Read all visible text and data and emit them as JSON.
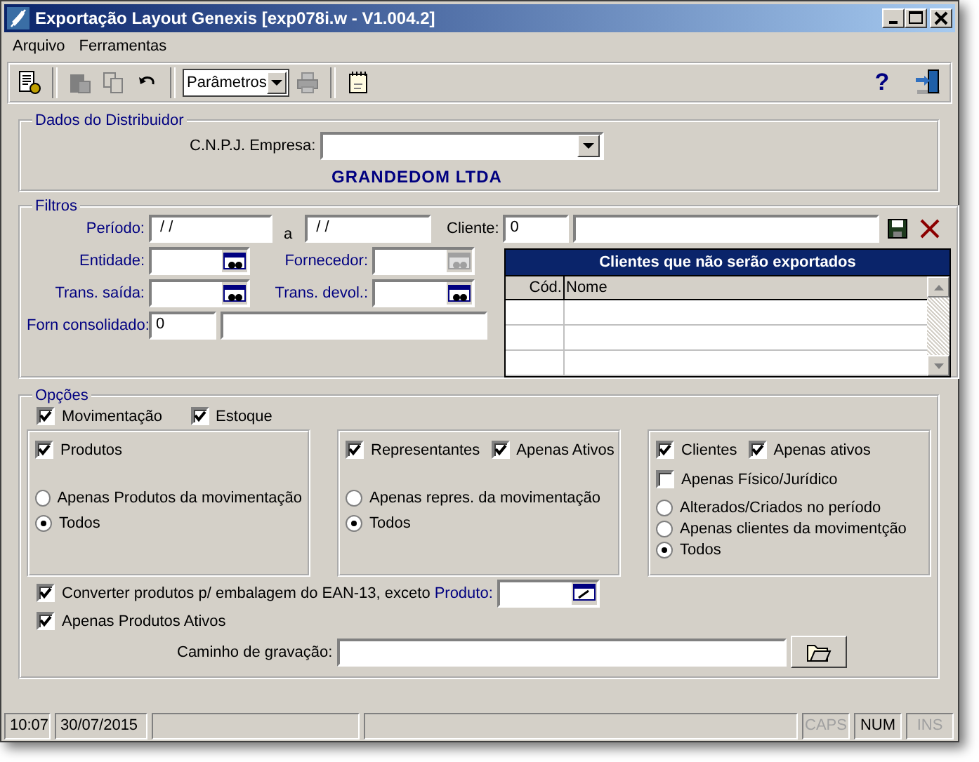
{
  "window": {
    "title": "Exportação Layout Genexis [exp078i.w - V1.004.2]"
  },
  "menu": [
    {
      "label": "Arquivo"
    },
    {
      "label": "Ferramentas"
    }
  ],
  "toolbar": {
    "combo_value": "Parâmetros",
    "help": "?"
  },
  "distribuidor": {
    "title": "Dados do Distribuidor",
    "cnpj_label": "C.N.P.J. Empresa:",
    "company": "GRANDEDOM LTDA"
  },
  "filtros": {
    "title": "Filtros",
    "periodo_label": "Período:",
    "periodo_from": " / /",
    "between": "a",
    "periodo_to": " / /",
    "cliente_label": "Cliente:",
    "cliente_code": "0",
    "lookups": [
      {
        "label": "Entidade:",
        "disabled": false
      },
      {
        "label": "Fornecedor:",
        "disabled": true
      },
      {
        "label": "Trans. saída:",
        "disabled": false
      },
      {
        "label": "Trans. devol.:",
        "disabled": false
      }
    ],
    "forn_label": "Forn consolidado:",
    "forn_value": "0"
  },
  "clientes_table": {
    "title": "Clientes que não serão exportados",
    "columns": [
      "Cód.",
      "Nome"
    ]
  },
  "opcoes": {
    "title": "Opções",
    "top": [
      {
        "label": "Movimentação",
        "checked": true
      },
      {
        "label": "Estoque",
        "checked": true
      }
    ],
    "panels": [
      {
        "check_rows": [
          [
            {
              "label": "Produtos",
              "checked": true
            }
          ]
        ],
        "radios": [
          {
            "label": "Apenas Produtos da movimentação",
            "selected": false
          },
          {
            "label": "Todos",
            "selected": true
          }
        ]
      },
      {
        "check_rows": [
          [
            {
              "label": "Representantes",
              "checked": true
            },
            {
              "label": "Apenas Ativos",
              "checked": true
            }
          ]
        ],
        "radios": [
          {
            "label": "Apenas repres. da movimentação",
            "selected": false
          },
          {
            "label": "Todos",
            "selected": true
          }
        ]
      },
      {
        "check_rows": [
          [
            {
              "label": "Clientes",
              "checked": true
            },
            {
              "label": "Apenas ativos",
              "checked": true
            }
          ],
          [
            {
              "label": "Apenas Físico/Jurídico",
              "checked": false
            }
          ]
        ],
        "radios": [
          {
            "label": "Alterados/Criados no período",
            "selected": false
          },
          {
            "label": "Apenas clientes da movimentção",
            "selected": false
          },
          {
            "label": "Todos",
            "selected": true
          }
        ]
      }
    ],
    "converter": {
      "label": "Converter produtos p/ embalagem do EAN-13, exceto",
      "field_label": "Produto:",
      "checked": true
    },
    "ativos": {
      "label": "Apenas Produtos Ativos",
      "checked": true
    },
    "caminho_label": "Caminho de gravação:"
  },
  "status_bar": {
    "time": "10:07",
    "date": "30/07/2015",
    "indicators": [
      {
        "label": "CAPS",
        "on": false
      },
      {
        "label": "NUM",
        "on": true
      },
      {
        "label": "INS",
        "on": false
      }
    ]
  }
}
